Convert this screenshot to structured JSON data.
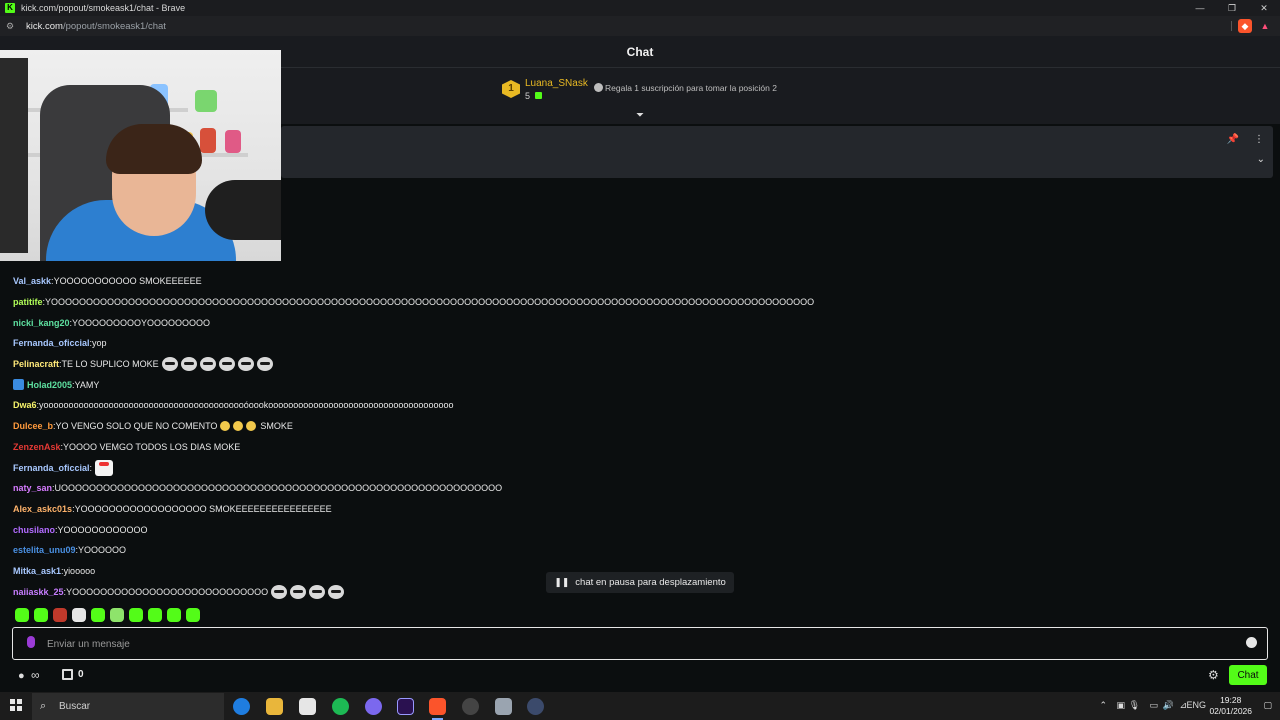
{
  "browser": {
    "title": "kick.com/popout/smokeask1/chat - Brave",
    "url_host": "kick.com",
    "url_path": "/popout/smokeask1/chat",
    "window_controls": [
      "—",
      "❐",
      "✕"
    ]
  },
  "chat": {
    "header_title": "Chat",
    "leaderboard": {
      "rank": "1",
      "gifter_name": "Luana_SNask",
      "gift_count": "5",
      "cta_text": "Regala 1 suscripción para tomar la posición 2"
    },
    "paused_text": "chat en pausa para desplazamiento",
    "input_placeholder": "Enviar un mensaje",
    "send_label": "Chat",
    "gift_count": "0",
    "points_symbol": "∞",
    "messages": [
      {
        "user": "Val_askk",
        "color": "#a8c8ff",
        "text": "YOOOOOOOOOOO SMOKEEEEEE",
        "emotes": 0
      },
      {
        "user": "patitife",
        "color": "#b2ff59",
        "text": "YOOOOOOOOOOOOOOOOOOOOOOOOOOOOOOOOOOOOOOOOOOOOOOOOOOOOOOOOOOOOOOOOOOOOOOOOOOOOOOOOOOOOOOOOOOOOOOOOOOOOOOOOOOOOO",
        "emotes": 0
      },
      {
        "user": "nicki_kang20",
        "color": "#5ee0a0",
        "text": "YOOOOOOOOOYOOOOOOOOO",
        "emotes": 0
      },
      {
        "user": "Fernanda_oficcial",
        "color": "#a8c8ff",
        "text": "yop",
        "emotes": 0
      },
      {
        "user": "Pelinacraft",
        "color": "#ffe97a",
        "text": "TE LO SUPLICO MOKE",
        "emotes": 6
      },
      {
        "user": "Holad2005",
        "color": "#5ee0a0",
        "text": "YAMY",
        "emotes": 0
      },
      {
        "user": "Dwa6",
        "color": "#f7f36b",
        "text": "yooooooooooooooooooooooooooooooooooooooooóoookooooooooooooooooooooooooooooooooooooo",
        "emotes": 0
      },
      {
        "user": "Dulcee_b",
        "color": "#ff9a3c",
        "text": "YO VENGO SOLO QUE NO COMENTO",
        "text2": "SMOKE",
        "emotes": 0
      },
      {
        "user": "ZenzenAsk",
        "color": "#e53935",
        "text": "YOOOO VEMGO TODOS LOS DIAS MOKE",
        "emotes": 0
      },
      {
        "user": "Fernanda_oficcial",
        "color": "#a8c8ff",
        "text": "",
        "emotes": 0
      },
      {
        "user": "naty_san",
        "color": "#d67bff",
        "text": "UOOOOOOOOOOOOOOOOOOOOOOOOOOOOOOOOOOOOOOOOOOOOOOOOOOOOOOOOOOOOOOO",
        "emotes": 0
      },
      {
        "user": "Alex_askc01s",
        "color": "#ffb36b",
        "text": "YOOOOOOOOOOOOOOOOOO SMOKEEEEEEEEEEEEEEEE",
        "emotes": 0
      },
      {
        "user": "chusilano",
        "color": "#b26bff",
        "text": "YOOOOOOOOOOOO",
        "emotes": 0
      },
      {
        "user": "estelita_unu09",
        "color": "#4a90e2",
        "text": "YOOOOOO",
        "emotes": 0
      },
      {
        "user": "Mitka_ask1",
        "color": "#a8c8ff",
        "text": "yiooooo",
        "emotes": 0
      },
      {
        "user": "naiiaskk_25",
        "color": "#c77dff",
        "text": "YOOOOOOOOOOOOOOOOOOOOOOOOOOOO",
        "emotes": 4
      }
    ]
  },
  "taskbar": {
    "search_placeholder": "Buscar",
    "language": "ENG",
    "time": "19:28",
    "date": "02/01/2026"
  }
}
